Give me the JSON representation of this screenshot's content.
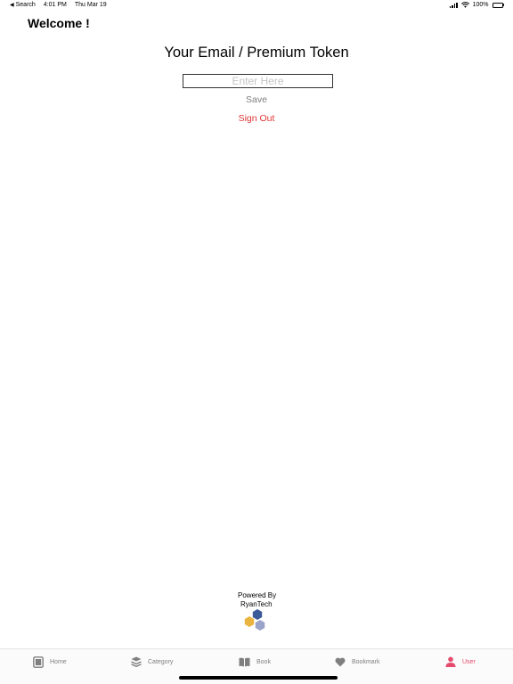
{
  "status_bar": {
    "back_label": "Search",
    "time": "4:01 PM",
    "date": "Thu Mar 19",
    "battery": "100%"
  },
  "header": {
    "title": "Welcome !"
  },
  "token_form": {
    "title": "Your Email / Premium Token",
    "input_value": "",
    "input_placeholder": "Enter Here",
    "save_label": "Save",
    "signout_label": "Sign Out"
  },
  "footer": {
    "powered_by": "Powered By",
    "company": "RyanTech"
  },
  "tab_bar": {
    "items": [
      {
        "label": "Home",
        "icon": "home-icon"
      },
      {
        "label": "Category",
        "icon": "layers-icon"
      },
      {
        "label": "Book",
        "icon": "open-book-icon"
      },
      {
        "label": "Bookmark",
        "icon": "heart-icon"
      },
      {
        "label": "User",
        "icon": "user-icon"
      }
    ],
    "active_index": 4
  },
  "colors": {
    "accent_red": "#e03535",
    "active_tab": "#e64a6c",
    "inactive_tab": "#7f7f7f",
    "save_text": "#7d7d7d",
    "logo_blue": "#3a5a9a",
    "logo_yellow": "#e9b540",
    "logo_lavender": "#9aa3c9"
  }
}
